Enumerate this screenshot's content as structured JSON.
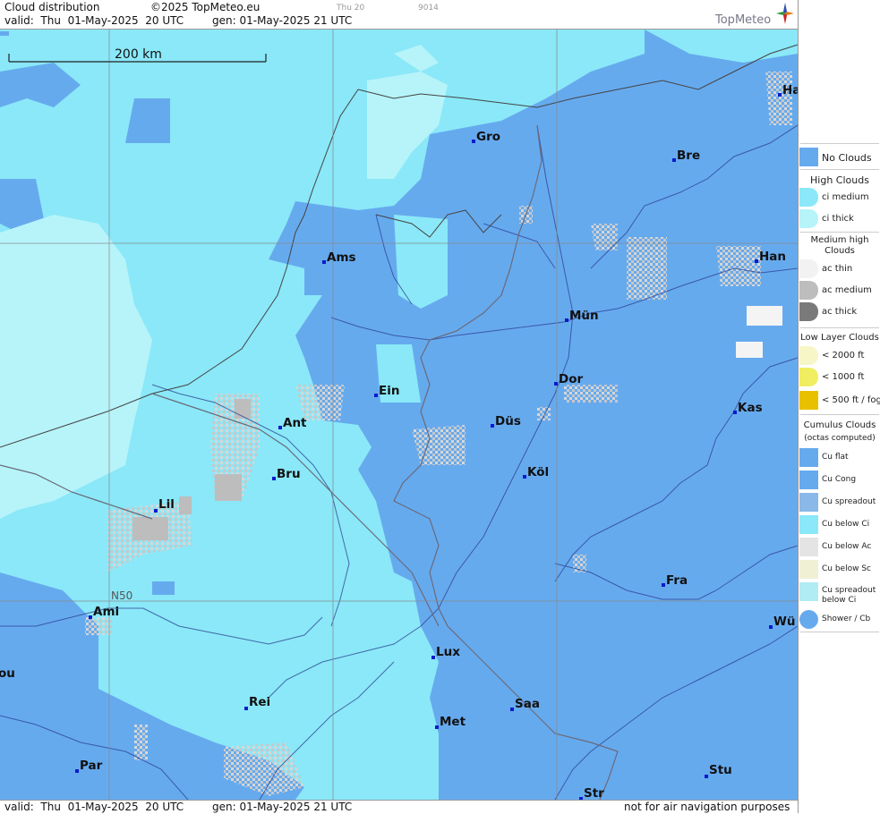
{
  "header": {
    "title": "Cloud distribution",
    "copyright": "©2025 TopMeteo.eu",
    "valid": "valid:  Thu  01-May-2025  20 UTC",
    "generated": "gen: 01-May-2025 21 UTC",
    "small_day": "Thu 20",
    "small_code": "9014",
    "logo": "TopMeteo"
  },
  "footer": {
    "valid": "valid:  Thu  01-May-2025  20 UTC",
    "generated": "gen: 01-May-2025 21 UTC",
    "disclaimer": "not for air navigation purposes"
  },
  "map": {
    "scale_label": "200 km",
    "lat_label": "N50",
    "colors": {
      "no_clouds": "#66aaee",
      "ci_medium": "#8ae8f8",
      "ci_thick": "#b6f4fa",
      "ac": "#dddddd",
      "grid": "#888888",
      "borders": "#6a6a7a",
      "rivers": "#2a3e8e"
    },
    "cities": [
      {
        "name": "Gro"
      },
      {
        "name": "Bre"
      },
      {
        "name": "Ha"
      },
      {
        "name": "Ams"
      },
      {
        "name": "Han"
      },
      {
        "name": "Mün"
      },
      {
        "name": "Dor"
      },
      {
        "name": "Ein"
      },
      {
        "name": "Kas"
      },
      {
        "name": "Ant"
      },
      {
        "name": "Düs"
      },
      {
        "name": "Bru"
      },
      {
        "name": "Köl"
      },
      {
        "name": "Lil"
      },
      {
        "name": "Fra"
      },
      {
        "name": "Ami"
      },
      {
        "name": "Wü"
      },
      {
        "name": "Lux"
      },
      {
        "name": "ou"
      },
      {
        "name": "Rei"
      },
      {
        "name": "Saa"
      },
      {
        "name": "Met"
      },
      {
        "name": "Par"
      },
      {
        "name": "Stu"
      },
      {
        "name": "Str"
      }
    ]
  },
  "legend": {
    "no_clouds": "No Clouds",
    "high_clouds": "High Clouds",
    "ci_medium": "ci medium",
    "ci_thick": "ci thick",
    "medium_high_clouds": "Medium high Clouds",
    "ac_thin": "ac thin",
    "ac_medium": "ac medium",
    "ac_thick": "ac thick",
    "low_layer_clouds": "Low Layer Clouds",
    "low_2000": "< 2000 ft",
    "low_1000": "< 1000 ft",
    "low_500": "< 500 ft / fog",
    "cumulus_clouds": "Cumulus Clouds",
    "octas_note": "(octas computed)",
    "cu_flat": "Cu flat",
    "cu_cong": "Cu Cong",
    "cu_spreadout": "Cu spreadout",
    "cu_below_ci": "Cu below Ci",
    "cu_below_ac": "Cu below Ac",
    "cu_below_sc": "Cu below Sc",
    "cu_spreadout_below_ci": "Cu spreadout below Ci",
    "shower_cb": "Shower / Cb"
  }
}
